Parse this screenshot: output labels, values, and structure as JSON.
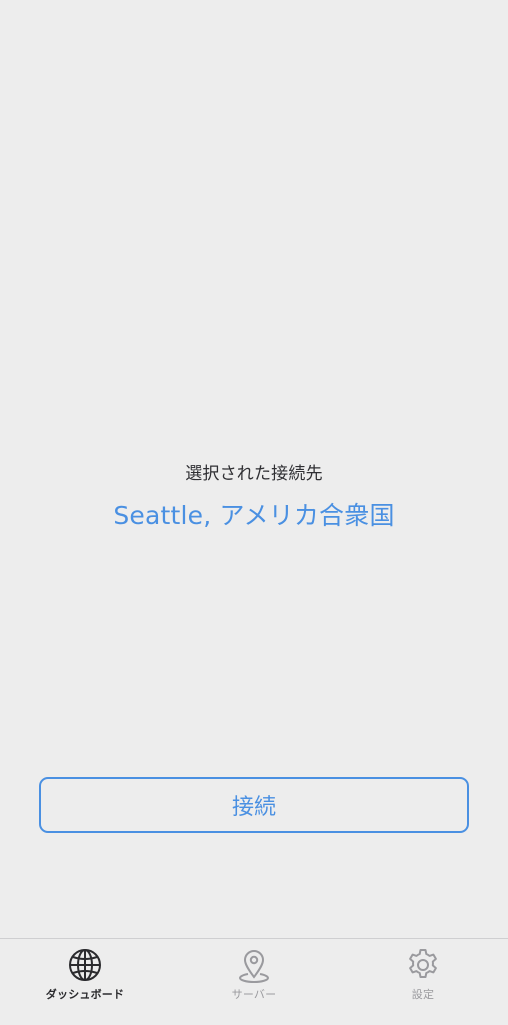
{
  "main": {
    "selected_label": "選択された接続先",
    "selected_destination": "Seattle, アメリカ合衆国",
    "connect_label": "接続"
  },
  "tabs": [
    {
      "label": "ダッシュボード",
      "icon": "globe-icon",
      "active": true
    },
    {
      "label": "サーバー",
      "icon": "location-pin-icon",
      "active": false
    },
    {
      "label": "設定",
      "icon": "gear-icon",
      "active": false
    }
  ],
  "colors": {
    "accent": "#4a90e2",
    "background": "#ededed",
    "text_primary": "#2f2f33",
    "tab_inactive": "#9a9a9e"
  }
}
